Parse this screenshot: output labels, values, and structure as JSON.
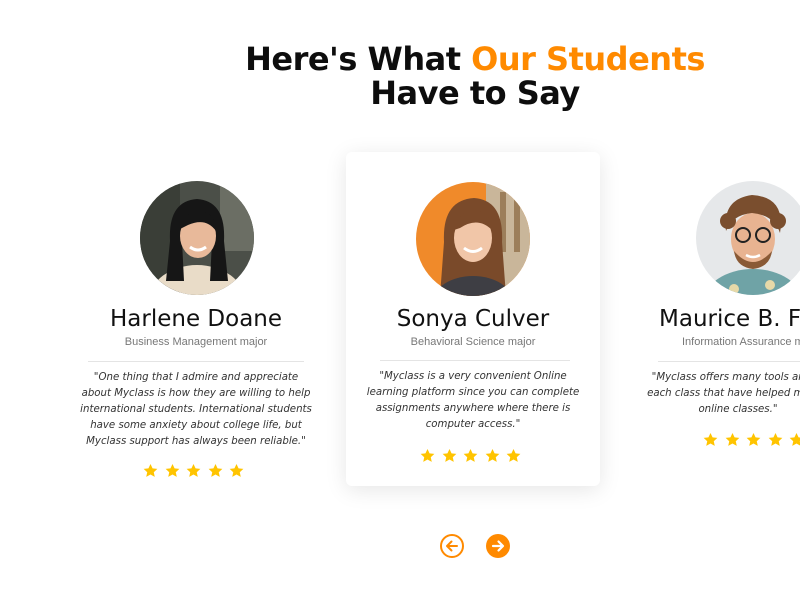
{
  "heading": {
    "line1_plain": "Here's What ",
    "line1_accent": "Our Students",
    "line2": "Have to Say"
  },
  "colors": {
    "accent": "#ff8a00",
    "star": "#ffc400"
  },
  "testimonials": [
    {
      "name": "Harlene Doane",
      "major": "Business Management major",
      "quote": "\"One thing that I admire and appreciate about Myclass is how they are willing to help international students. International students have some anxiety about college life, but Myclass support has always been reliable.\"",
      "rating": 5
    },
    {
      "name": "Sonya Culver",
      "major": "Behavioral Science major",
      "quote": "\"Myclass is a very convenient Online learning platform since you can complete assignments anywhere where there is computer access.\"",
      "rating": 5
    },
    {
      "name": "Maurice B. Fe",
      "major": "Information Assurance m",
      "quote": "\"Myclass offers many tools and m each class that have helped me my  online classes.\"",
      "rating": 5
    }
  ],
  "navigation": {
    "prev_icon": "arrow-left-circle-icon",
    "next_icon": "arrow-right-circle-icon"
  }
}
